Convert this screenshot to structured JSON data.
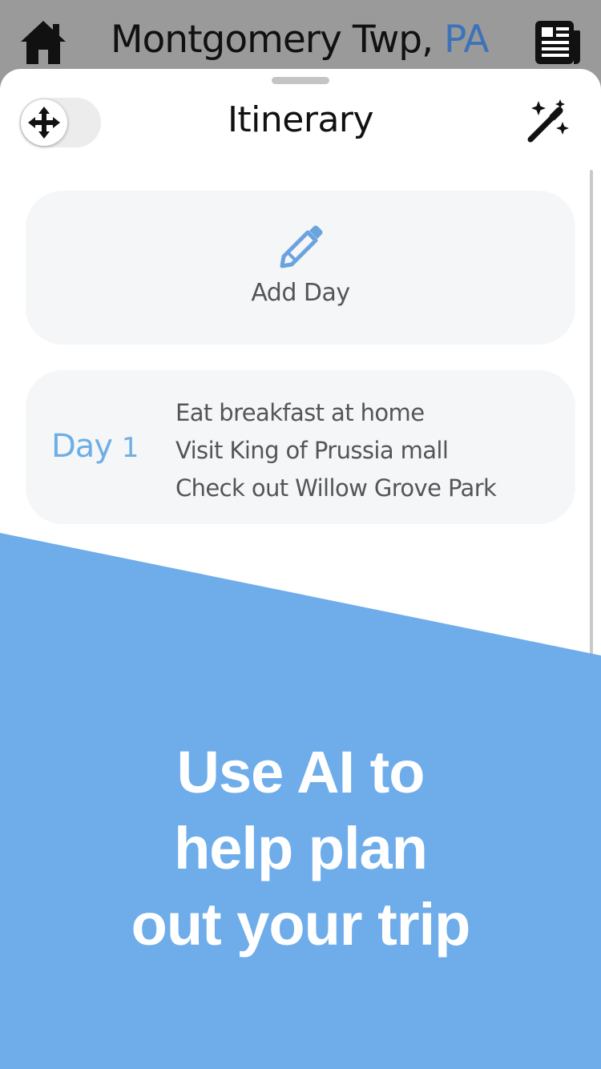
{
  "header": {
    "city": "Montgomery Twp,",
    "state": "PA",
    "home_icon": "home-icon",
    "news_icon": "newspaper-icon"
  },
  "sheet": {
    "title": "Itinerary",
    "toggle_icon": "move-arrows-icon",
    "magic_icon": "magic-wand-icon"
  },
  "add_day": {
    "label": "Add Day",
    "icon": "pencil-icon"
  },
  "days": [
    {
      "label": "Day",
      "number": "1",
      "activities": [
        "Eat breakfast at home",
        "Visit King of Prussia mall",
        "Check out Willow Grove Park"
      ]
    }
  ],
  "promo": {
    "lines": [
      "Use AI to",
      "help plan",
      "out your trip"
    ]
  },
  "colors": {
    "accent_blue": "#6daee5",
    "promo_blue": "#6eadea",
    "state_blue": "#3d73b8",
    "card_bg": "#f5f6f8"
  }
}
